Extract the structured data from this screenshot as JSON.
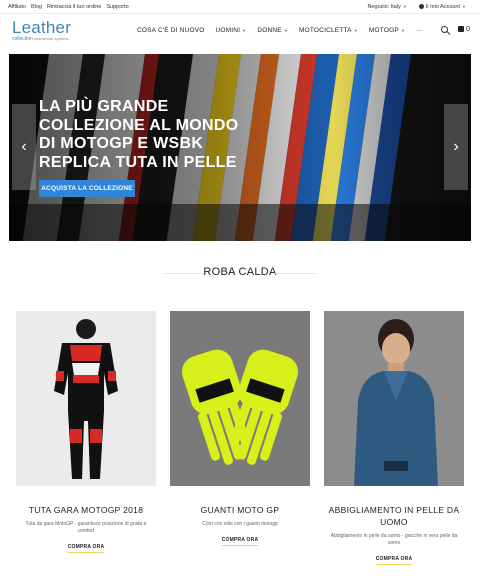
{
  "topbar": {
    "links": [
      "Affiliato",
      "Blog",
      "Rintraccia il tuo ordine",
      "Supporto"
    ],
    "region": "Negozio: Italy",
    "account": "Il mio Account"
  },
  "logo": {
    "main": "Leather",
    "sub": "collection",
    "tagline": "ispirazione sportiva"
  },
  "nav": {
    "items": [
      "COSA C'È DI NUOVO",
      "UOMINI",
      "DONNE",
      "MOTOCICLETTA",
      "MOTOGP",
      "···"
    ]
  },
  "cart": {
    "count": "0"
  },
  "hero": {
    "title": "LA PIÙ GRANDE COLLEZIONE AL MONDO DI MOTOGP E WSBK REPLICA TUTA IN PELLE",
    "button": "ACQUISTA LA COLLEZIONE",
    "prev": "‹",
    "next": "›"
  },
  "section": {
    "title": "ROBA CALDA"
  },
  "products": [
    {
      "title": "TUTA GARA MOTOGP 2018",
      "desc": "Tuta da gara MotoGP - garantisce posizione di guida e comfort",
      "button": "COMPRA ORA"
    },
    {
      "title": "GUANTI MOTO GP",
      "desc": "Corri con stile con i guanti motogp",
      "button": "COMPRA ORA"
    },
    {
      "title": "ABBIGLIAMENTO IN PELLE DA UOMO",
      "desc": "Abbigliamento in pelle da uomo - giacche in vera pelle da uomo",
      "button": "COMPRA ORA"
    }
  ],
  "colors": {
    "accent": "#2f86d8",
    "logo": "#3e86b8",
    "highlight": "#ecd45a"
  }
}
